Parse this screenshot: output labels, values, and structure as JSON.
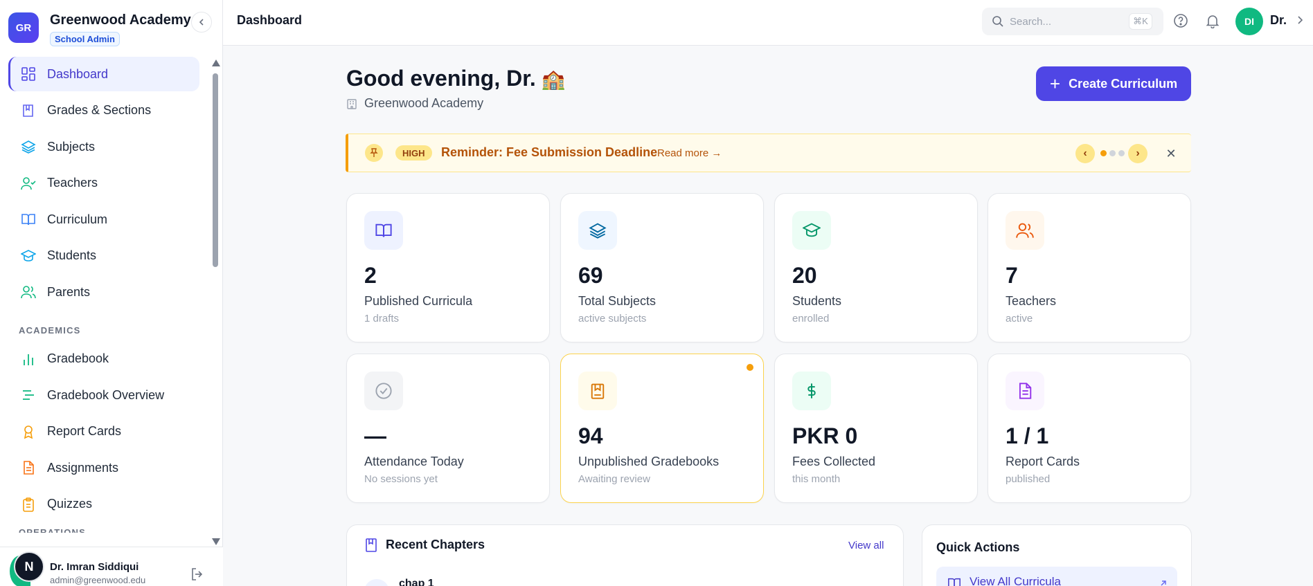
{
  "brand": {
    "initials": "GR",
    "name": "Greenwood Academy",
    "role": "School Admin"
  },
  "sidebar": {
    "items": [
      {
        "label": "Dashboard",
        "icon": "grid-icon"
      },
      {
        "label": "Grades & Sections",
        "icon": "book-marked-icon"
      },
      {
        "label": "Subjects",
        "icon": "layers-icon"
      },
      {
        "label": "Teachers",
        "icon": "user-check-icon"
      },
      {
        "label": "Curriculum",
        "icon": "book-open-icon"
      },
      {
        "label": "Students",
        "icon": "graduation-cap-icon"
      },
      {
        "label": "Parents",
        "icon": "users-icon"
      }
    ],
    "section_academics": "ACADEMICS",
    "academics": [
      {
        "label": "Gradebook",
        "icon": "bar-chart-icon"
      },
      {
        "label": "Gradebook Overview",
        "icon": "list-icon"
      },
      {
        "label": "Report Cards",
        "icon": "award-icon"
      },
      {
        "label": "Assignments",
        "icon": "file-text-icon"
      },
      {
        "label": "Quizzes",
        "icon": "clipboard-icon"
      }
    ],
    "section_operations": "OPERATIONS"
  },
  "user": {
    "initial": "N",
    "name": "Dr. Imran Siddiqui",
    "email": "admin@greenwood.edu"
  },
  "topbar": {
    "title": "Dashboard",
    "search_placeholder": "Search...",
    "shortcut": "⌘K",
    "avatar_initials": "DI",
    "user_short": "Dr."
  },
  "main": {
    "greeting": "Good evening, Dr.",
    "greeting_emoji": "🏫",
    "school": "Greenwood Academy",
    "create_button": "Create Curriculum",
    "banner": {
      "priority": "HIGH",
      "title": "Reminder: Fee Submission Deadline",
      "read_more": "Read more →",
      "pages": 3,
      "current_page": 1
    },
    "stats": [
      {
        "value": "2",
        "label": "Published Curricula",
        "sub": "1 drafts",
        "icon": "book-open-icon"
      },
      {
        "value": "69",
        "label": "Total Subjects",
        "sub": "active subjects",
        "icon": "layers-icon"
      },
      {
        "value": "20",
        "label": "Students",
        "sub": "enrolled",
        "icon": "graduation-cap-icon"
      },
      {
        "value": "7",
        "label": "Teachers",
        "sub": "active",
        "icon": "users-icon"
      },
      {
        "value": "—",
        "label": "Attendance Today",
        "sub": "No sessions yet",
        "icon": "check-circle-icon"
      },
      {
        "value": "94",
        "label": "Unpublished Gradebooks",
        "sub": "Awaiting review",
        "icon": "bookmark-book-icon"
      },
      {
        "value": "PKR 0",
        "label": "Fees Collected",
        "sub": "this month",
        "icon": "dollar-icon"
      },
      {
        "value": "1 / 1",
        "label": "Report Cards",
        "sub": "published",
        "icon": "file-text-icon"
      }
    ],
    "recent_chapters": {
      "title": "Recent Chapters",
      "view_all": "View all",
      "first_item": "chap 1"
    },
    "quick_actions": {
      "title": "Quick Actions",
      "first_action": "View All Curricula"
    }
  },
  "colors": {
    "accent": "#4f46e5",
    "banner_bg": "#fffbeb",
    "banner_accent": "#f59e0b",
    "success": "#10b981"
  }
}
